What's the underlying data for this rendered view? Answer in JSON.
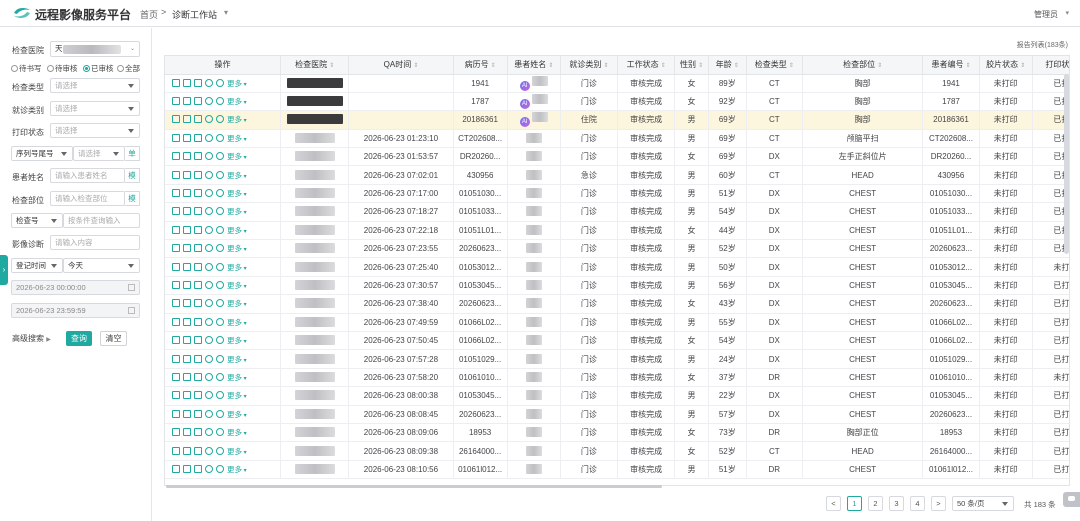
{
  "header": {
    "app_title": "远程影像服务平台",
    "breadcrumb_home": "首页",
    "breadcrumb_sep": ">",
    "breadcrumb_current": "诊断工作站",
    "user": "管理员"
  },
  "sidebar": {
    "hospital_label": "检查医院",
    "hospital_value": "天",
    "radios": [
      {
        "label": "待书写",
        "checked": false
      },
      {
        "label": "待审核",
        "checked": false
      },
      {
        "label": "已审核",
        "checked": true
      },
      {
        "label": "全部",
        "checked": false
      }
    ],
    "exam_type_label": "检查类型",
    "exam_type_ph": "请选择",
    "visit_type_label": "就诊类别",
    "visit_type_ph": "请选择",
    "print_label": "打印状态",
    "print_ph": "请选择",
    "seq_select": "序列号尾号",
    "seq_ph": "请选择",
    "seq_btn": "单",
    "patient_label": "患者姓名",
    "patient_ph": "请输入患者姓名",
    "patient_btn": "模",
    "part_label": "检查部位",
    "part_ph": "请输入检查部位",
    "part_btn": "模",
    "examno_select": "检查号",
    "examno_ph": "按条件查询输入",
    "diag_label": "影像诊断",
    "diag_ph": "请输入内容",
    "reg_select": "登记时间",
    "reg_value": "今天",
    "date_start": "2026-06-23 00:00:00",
    "date_end": "2026-06-23 23:59:59",
    "adv_search": "高级搜索",
    "query_btn": "查询",
    "clear_btn": "清空"
  },
  "table": {
    "report_count": "报告列表(183条)",
    "columns": [
      "操作",
      "检查医院",
      "QA时间",
      "病历号",
      "患者姓名",
      "就诊类别",
      "工作状态",
      "性别",
      "年龄",
      "检查类型",
      "检查部位",
      "患者编号",
      "胶片状态",
      "打印状态"
    ],
    "more_label": "更多",
    "rows": [
      {
        "qa": "",
        "mrn": "1941",
        "name_ai": true,
        "visit": "门诊",
        "status": "审核完成",
        "sex": "女",
        "age": "89岁",
        "type": "CT",
        "part": "胸部",
        "pid": "1941",
        "film": "未打印",
        "print": "已打"
      },
      {
        "qa": "",
        "mrn": "1787",
        "name_ai": true,
        "visit": "门诊",
        "status": "审核完成",
        "sex": "女",
        "age": "92岁",
        "type": "CT",
        "part": "胸部",
        "pid": "1787",
        "film": "未打印",
        "print": "已打"
      },
      {
        "qa": "",
        "mrn": "20186361",
        "name_ai": true,
        "visit": "住院",
        "status": "审核完成",
        "sex": "男",
        "age": "69岁",
        "type": "CT",
        "part": "胸部",
        "pid": "20186361",
        "film": "未打印",
        "print": "已打"
      },
      {
        "qa": "2026-06-23 01:23:10",
        "mrn": "CT202608...",
        "visit": "门诊",
        "status": "审核完成",
        "sex": "男",
        "age": "69岁",
        "type": "CT",
        "part": "颅脑平扫",
        "pid": "CT202608...",
        "film": "未打印",
        "print": "已打"
      },
      {
        "qa": "2026-06-23 01:53:57",
        "mrn": "DR20260...",
        "visit": "门诊",
        "status": "审核完成",
        "sex": "女",
        "age": "69岁",
        "type": "DX",
        "part": "左手正斜位片",
        "pid": "DR20260...",
        "film": "未打印",
        "print": "已打"
      },
      {
        "qa": "2026-06-23 07:02:01",
        "mrn": "430956",
        "visit": "急诊",
        "status": "审核完成",
        "sex": "男",
        "age": "60岁",
        "type": "CT",
        "part": "HEAD",
        "pid": "430956",
        "film": "未打印",
        "print": "已打"
      },
      {
        "qa": "2026-06-23 07:17:00",
        "mrn": "01051030...",
        "visit": "门诊",
        "status": "审核完成",
        "sex": "男",
        "age": "51岁",
        "type": "DX",
        "part": "CHEST",
        "pid": "01051030...",
        "film": "未打印",
        "print": "已打"
      },
      {
        "qa": "2026-06-23 07:18:27",
        "mrn": "01051033...",
        "visit": "门诊",
        "status": "审核完成",
        "sex": "男",
        "age": "54岁",
        "type": "DX",
        "part": "CHEST",
        "pid": "01051033...",
        "film": "未打印",
        "print": "已打"
      },
      {
        "qa": "2026-06-23 07:22:18",
        "mrn": "01051L01...",
        "visit": "门诊",
        "status": "审核完成",
        "sex": "女",
        "age": "44岁",
        "type": "DX",
        "part": "CHEST",
        "pid": "01051L01...",
        "film": "未打印",
        "print": "已打"
      },
      {
        "qa": "2026-06-23 07:23:55",
        "mrn": "20260623...",
        "visit": "门诊",
        "status": "审核完成",
        "sex": "男",
        "age": "52岁",
        "type": "DX",
        "part": "CHEST",
        "pid": "20260623...",
        "film": "未打印",
        "print": "已打"
      },
      {
        "qa": "2026-06-23 07:25:40",
        "mrn": "01053012...",
        "visit": "门诊",
        "status": "审核完成",
        "sex": "男",
        "age": "50岁",
        "type": "DX",
        "part": "CHEST",
        "pid": "01053012...",
        "film": "未打印",
        "print": "未打"
      },
      {
        "qa": "2026-06-23 07:30:57",
        "mrn": "01053045...",
        "visit": "门诊",
        "status": "审核完成",
        "sex": "男",
        "age": "56岁",
        "type": "DX",
        "part": "CHEST",
        "pid": "01053045...",
        "film": "未打印",
        "print": "已打"
      },
      {
        "qa": "2026-06-23 07:38:40",
        "mrn": "20260623...",
        "visit": "门诊",
        "status": "审核完成",
        "sex": "女",
        "age": "43岁",
        "type": "DX",
        "part": "CHEST",
        "pid": "20260623...",
        "film": "未打印",
        "print": "已打"
      },
      {
        "qa": "2026-06-23 07:49:59",
        "mrn": "01066L02...",
        "visit": "门诊",
        "status": "审核完成",
        "sex": "男",
        "age": "55岁",
        "type": "DX",
        "part": "CHEST",
        "pid": "01066L02...",
        "film": "未打印",
        "print": "已打"
      },
      {
        "qa": "2026-06-23 07:50:45",
        "mrn": "01066L02...",
        "visit": "门诊",
        "status": "审核完成",
        "sex": "女",
        "age": "54岁",
        "type": "DX",
        "part": "CHEST",
        "pid": "01066L02...",
        "film": "未打印",
        "print": "已打"
      },
      {
        "qa": "2026-06-23 07:57:28",
        "mrn": "01051029...",
        "visit": "门诊",
        "status": "审核完成",
        "sex": "男",
        "age": "24岁",
        "type": "DX",
        "part": "CHEST",
        "pid": "01051029...",
        "film": "未打印",
        "print": "已打"
      },
      {
        "qa": "2026-06-23 07:58:20",
        "mrn": "01061010...",
        "visit": "门诊",
        "status": "审核完成",
        "sex": "女",
        "age": "37岁",
        "type": "DR",
        "part": "CHEST",
        "pid": "01061010...",
        "film": "未打印",
        "print": "未打"
      },
      {
        "qa": "2026-06-23 08:00:38",
        "mrn": "01053045...",
        "visit": "门诊",
        "status": "审核完成",
        "sex": "男",
        "age": "22岁",
        "type": "DX",
        "part": "CHEST",
        "pid": "01053045...",
        "film": "未打印",
        "print": "已打"
      },
      {
        "qa": "2026-06-23 08:08:45",
        "mrn": "20260623...",
        "visit": "门诊",
        "status": "审核完成",
        "sex": "男",
        "age": "57岁",
        "type": "DX",
        "part": "CHEST",
        "pid": "20260623...",
        "film": "未打印",
        "print": "已打"
      },
      {
        "qa": "2026-06-23 08:09:06",
        "mrn": "18953",
        "visit": "门诊",
        "status": "审核完成",
        "sex": "女",
        "age": "73岁",
        "type": "DR",
        "part": "胸部正位",
        "pid": "18953",
        "film": "未打印",
        "print": "已打"
      },
      {
        "qa": "2026-06-23 08:09:38",
        "mrn": "26164000...",
        "visit": "门诊",
        "status": "审核完成",
        "sex": "女",
        "age": "52岁",
        "type": "CT",
        "part": "HEAD",
        "pid": "26164000...",
        "film": "未打印",
        "print": "已打"
      },
      {
        "qa": "2026-06-23 08:10:56",
        "mrn": "01061l012...",
        "visit": "门诊",
        "status": "审核完成",
        "sex": "男",
        "age": "51岁",
        "type": "DR",
        "part": "CHEST",
        "pid": "01061l012...",
        "film": "未打印",
        "print": "已打"
      }
    ]
  },
  "pagination": {
    "pages": [
      "1",
      "2",
      "3",
      "4"
    ],
    "current": "1",
    "prev": "<",
    "next": ">",
    "page_size": "50 条/页",
    "total": "共 183 条"
  },
  "colors": {
    "accent": "#1fa9a0",
    "link_blue": "#2a78d6",
    "emergency_red": "#e0453a",
    "highlight_row": "#fdf6de"
  }
}
